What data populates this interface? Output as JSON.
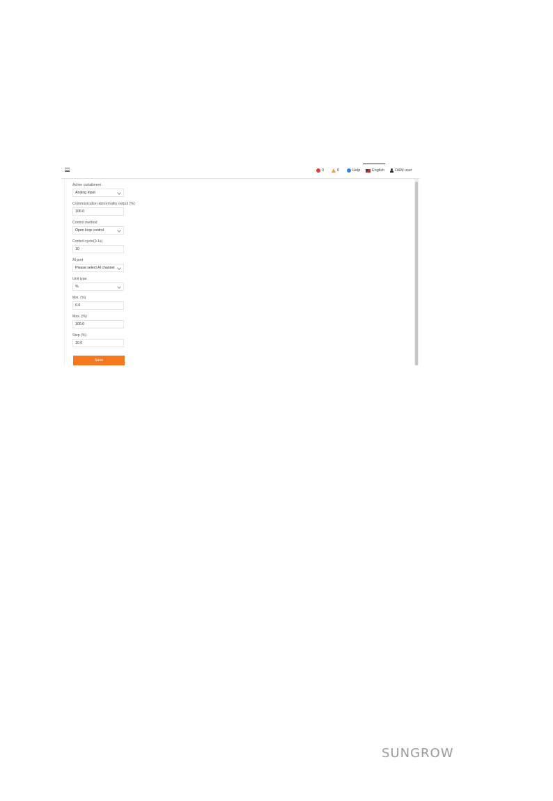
{
  "topbar": {
    "fault_count": "0",
    "alarm_count": "0",
    "help_label": "Help",
    "language_label": "English",
    "user_label": "O&M user"
  },
  "form": {
    "fields": [
      {
        "label": "Active curtailment",
        "value": "Analog input",
        "type": "select"
      },
      {
        "label": "Communication abnormality output (%)",
        "value": "100.0",
        "type": "input"
      },
      {
        "label": "Control method",
        "value": "Open loop control",
        "type": "select"
      },
      {
        "label": "Control cycle(0.1s)",
        "value": "10",
        "type": "input"
      },
      {
        "label": "AI port",
        "value": "Please select AI channel",
        "type": "select"
      },
      {
        "label": "Unit type",
        "value": "%",
        "type": "select"
      },
      {
        "label": "Min. (%)",
        "value": "0.0",
        "type": "input"
      },
      {
        "label": "Max. (%)",
        "value": "100.0",
        "type": "input"
      },
      {
        "label": "Step (%)",
        "value": "10.0",
        "type": "input"
      }
    ],
    "save_label": "Save"
  },
  "brand": {
    "logo_text": "SUNGROW"
  },
  "colors": {
    "accent": "#f5781f",
    "fault": "#e23b3b",
    "alarm": "#f0a020",
    "help": "#2f80ed"
  }
}
